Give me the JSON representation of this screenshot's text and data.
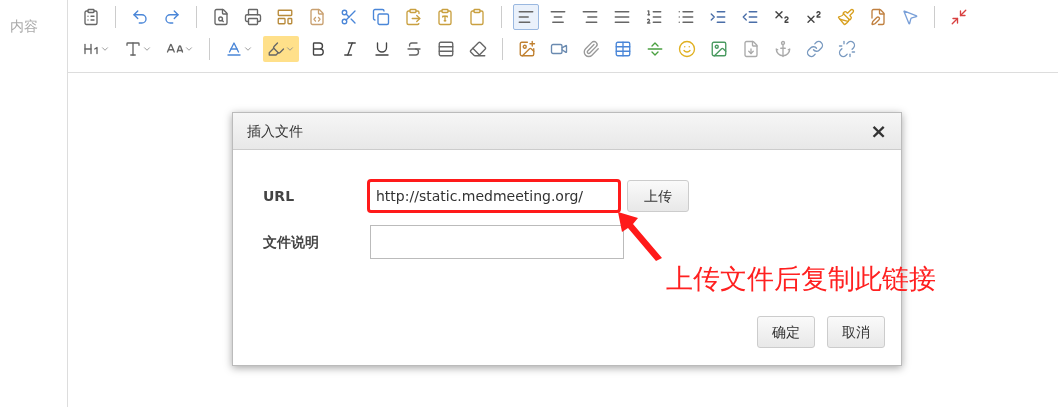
{
  "field_label": "内容",
  "toolbar": {
    "alignment": [
      {
        "selected": true
      },
      {
        "selected": false
      },
      {
        "selected": false
      },
      {
        "selected": false
      }
    ]
  },
  "dialog": {
    "title": "插入文件",
    "close": "×",
    "fields": [
      {
        "label": "URL",
        "value": "http://static.medmeeting.org/",
        "highlighted": true,
        "button": "上传"
      },
      {
        "label": "文件说明",
        "highlighted": false
      }
    ],
    "buttons": [
      "确定",
      "取消"
    ]
  },
  "annotation": "上传文件后复制此链接"
}
